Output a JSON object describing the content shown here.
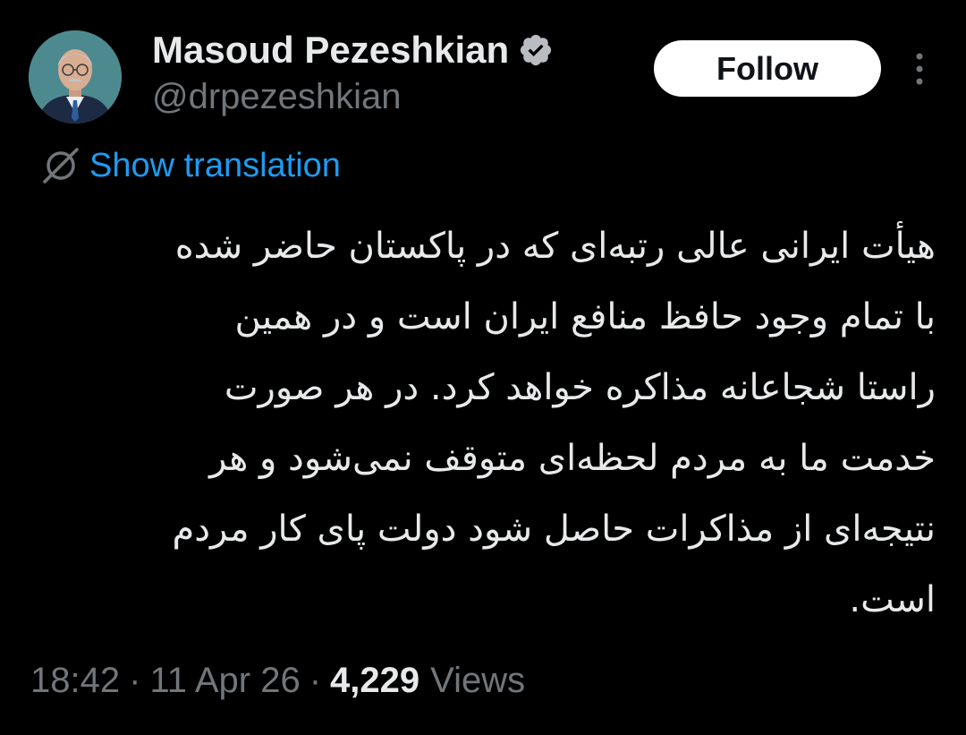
{
  "user": {
    "display_name": "Masoud Pezeshkian",
    "handle": "@drpezeshkian",
    "verified": true
  },
  "actions": {
    "follow_label": "Follow",
    "more_icon": "more-vertical-icon"
  },
  "translation": {
    "label": "Show translation",
    "icon": "globe-icon"
  },
  "tweet": {
    "lines": [
      "هیأت ایرانی عالی رتبه‌ای که در پاکستان حاضر شده",
      "با تمام وجود حافظ منافع ایران است و در همین",
      "راستا شجاعانه مذاکره خواهد کرد. در هر صورت",
      "خدمت ما به مردم لحظه‌ای متوقف نمی‌شود و هر",
      "نتیجه‌ای از مذاکرات حاصل شود دولت پای کار مردم",
      "است."
    ]
  },
  "meta": {
    "time": "18:42",
    "separator": "·",
    "date": "11 Apr 26",
    "views_count": "4,229",
    "views_label": "Views"
  },
  "colors": {
    "background": "#000000",
    "text_primary": "#e7e9ea",
    "text_secondary": "#71767b",
    "link": "#1d9bf0",
    "verified_badge": "#b9bdc2"
  }
}
